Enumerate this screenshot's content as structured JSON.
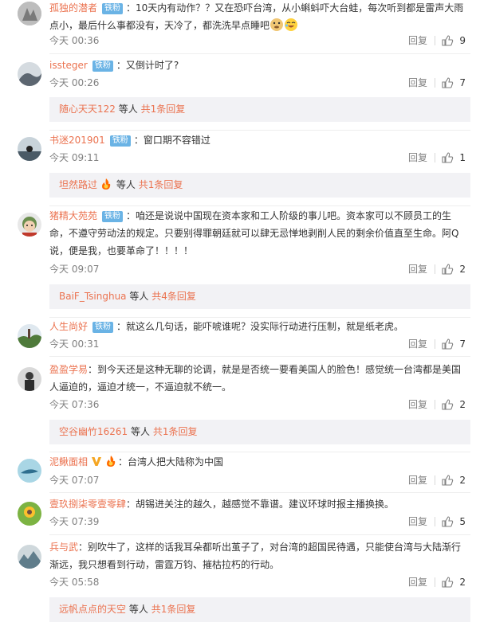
{
  "comments": [
    {
      "user": "孤独的潜者",
      "badge": "铁粉",
      "text": "10天内有动作？？又在恐吓台湾，从小蝌蚪吓大台蛙，每次听到都是雷声大雨点小，最后什么事都没有，天冷了，都洗洗早点睡吧",
      "time": "今天 00:36",
      "reply": "回复",
      "likes": "9",
      "emoji": [
        "doge-emoji",
        "laugh-emoji"
      ]
    },
    {
      "user": "issteger",
      "badge": "铁粉",
      "text": "又倒计时了?",
      "time": "今天 00:26",
      "reply": "回复",
      "likes": "7",
      "sub": {
        "user": "随心天天122",
        "etc": "等人",
        "more": "共1条回复"
      }
    },
    {
      "user": "书迷201901",
      "badge": "铁粉",
      "text": "窗口期不容错过",
      "time": "今天 09:11",
      "reply": "回复",
      "likes": "1",
      "sub": {
        "user": "坦然路过",
        "etc": "等人",
        "more": "共1条回复"
      }
    },
    {
      "user": "猪精大苑苑",
      "badge": "铁粉",
      "text": "咱还是说说中国现在资本家和工人阶级的事儿吧。资本家可以不顾员工的生命，不遵守劳动法的规定。只要别得罪朝廷就可以肆无忌惮地剥削人民的剩余价值直至生命。阿Q说，便是我，也要革命了！！！！",
      "time": "今天 09:07",
      "reply": "回复",
      "likes": "2",
      "sub": {
        "user": "BaiF_Tsinghua",
        "etc": "等人",
        "more": "共4条回复"
      }
    },
    {
      "user": "人生尚好",
      "badge": "铁粉",
      "text": "就这么几句话，能吓唬谁呢？没实际行动进行压制，就是纸老虎。",
      "time": "今天 00:31",
      "reply": "回复",
      "likes": "7"
    },
    {
      "user": "盈盈学易",
      "text": "到今天还是这种无聊的论调，就是是否统一要看美国人的脸色！感觉统一台湾都是美国人逼迫的，逼迫才统一，不逼迫就不统一。",
      "time": "今天 07:36",
      "reply": "回复",
      "likes": "2",
      "sub": {
        "user": "空谷幽竹16261",
        "etc": "等人",
        "more": "共1条回复"
      }
    },
    {
      "user": "泥鳅面相",
      "text": "台湾人把大陆称为中国",
      "time": "今天 07:07",
      "reply": "回复",
      "likes": "2"
    },
    {
      "user": "壹玖捌柒零壹零肆",
      "text": "胡锡进关注的越久，越感觉不靠谱。建议环球时报主播换换。",
      "time": "今天 07:39",
      "reply": "回复",
      "likes": "5"
    },
    {
      "user": "兵与武",
      "text": "别吹牛了，这样的话我耳朵都听出茧子了，对台湾的超国民待遇，只能使台湾与大陆渐行渐远，我只想看到行动，雷霆万钧、摧枯拉朽的行动。",
      "time": "今天 05:58",
      "reply": "回复",
      "likes": "2",
      "sub": {
        "user": "远帆点点的天空",
        "etc": "等人",
        "more": "共1条回复"
      }
    }
  ],
  "colors": {
    "username": "#eb7350",
    "badge_bg": "#6ab3e5",
    "meta": "#808080",
    "subbox_bg": "#f2f2f5"
  }
}
